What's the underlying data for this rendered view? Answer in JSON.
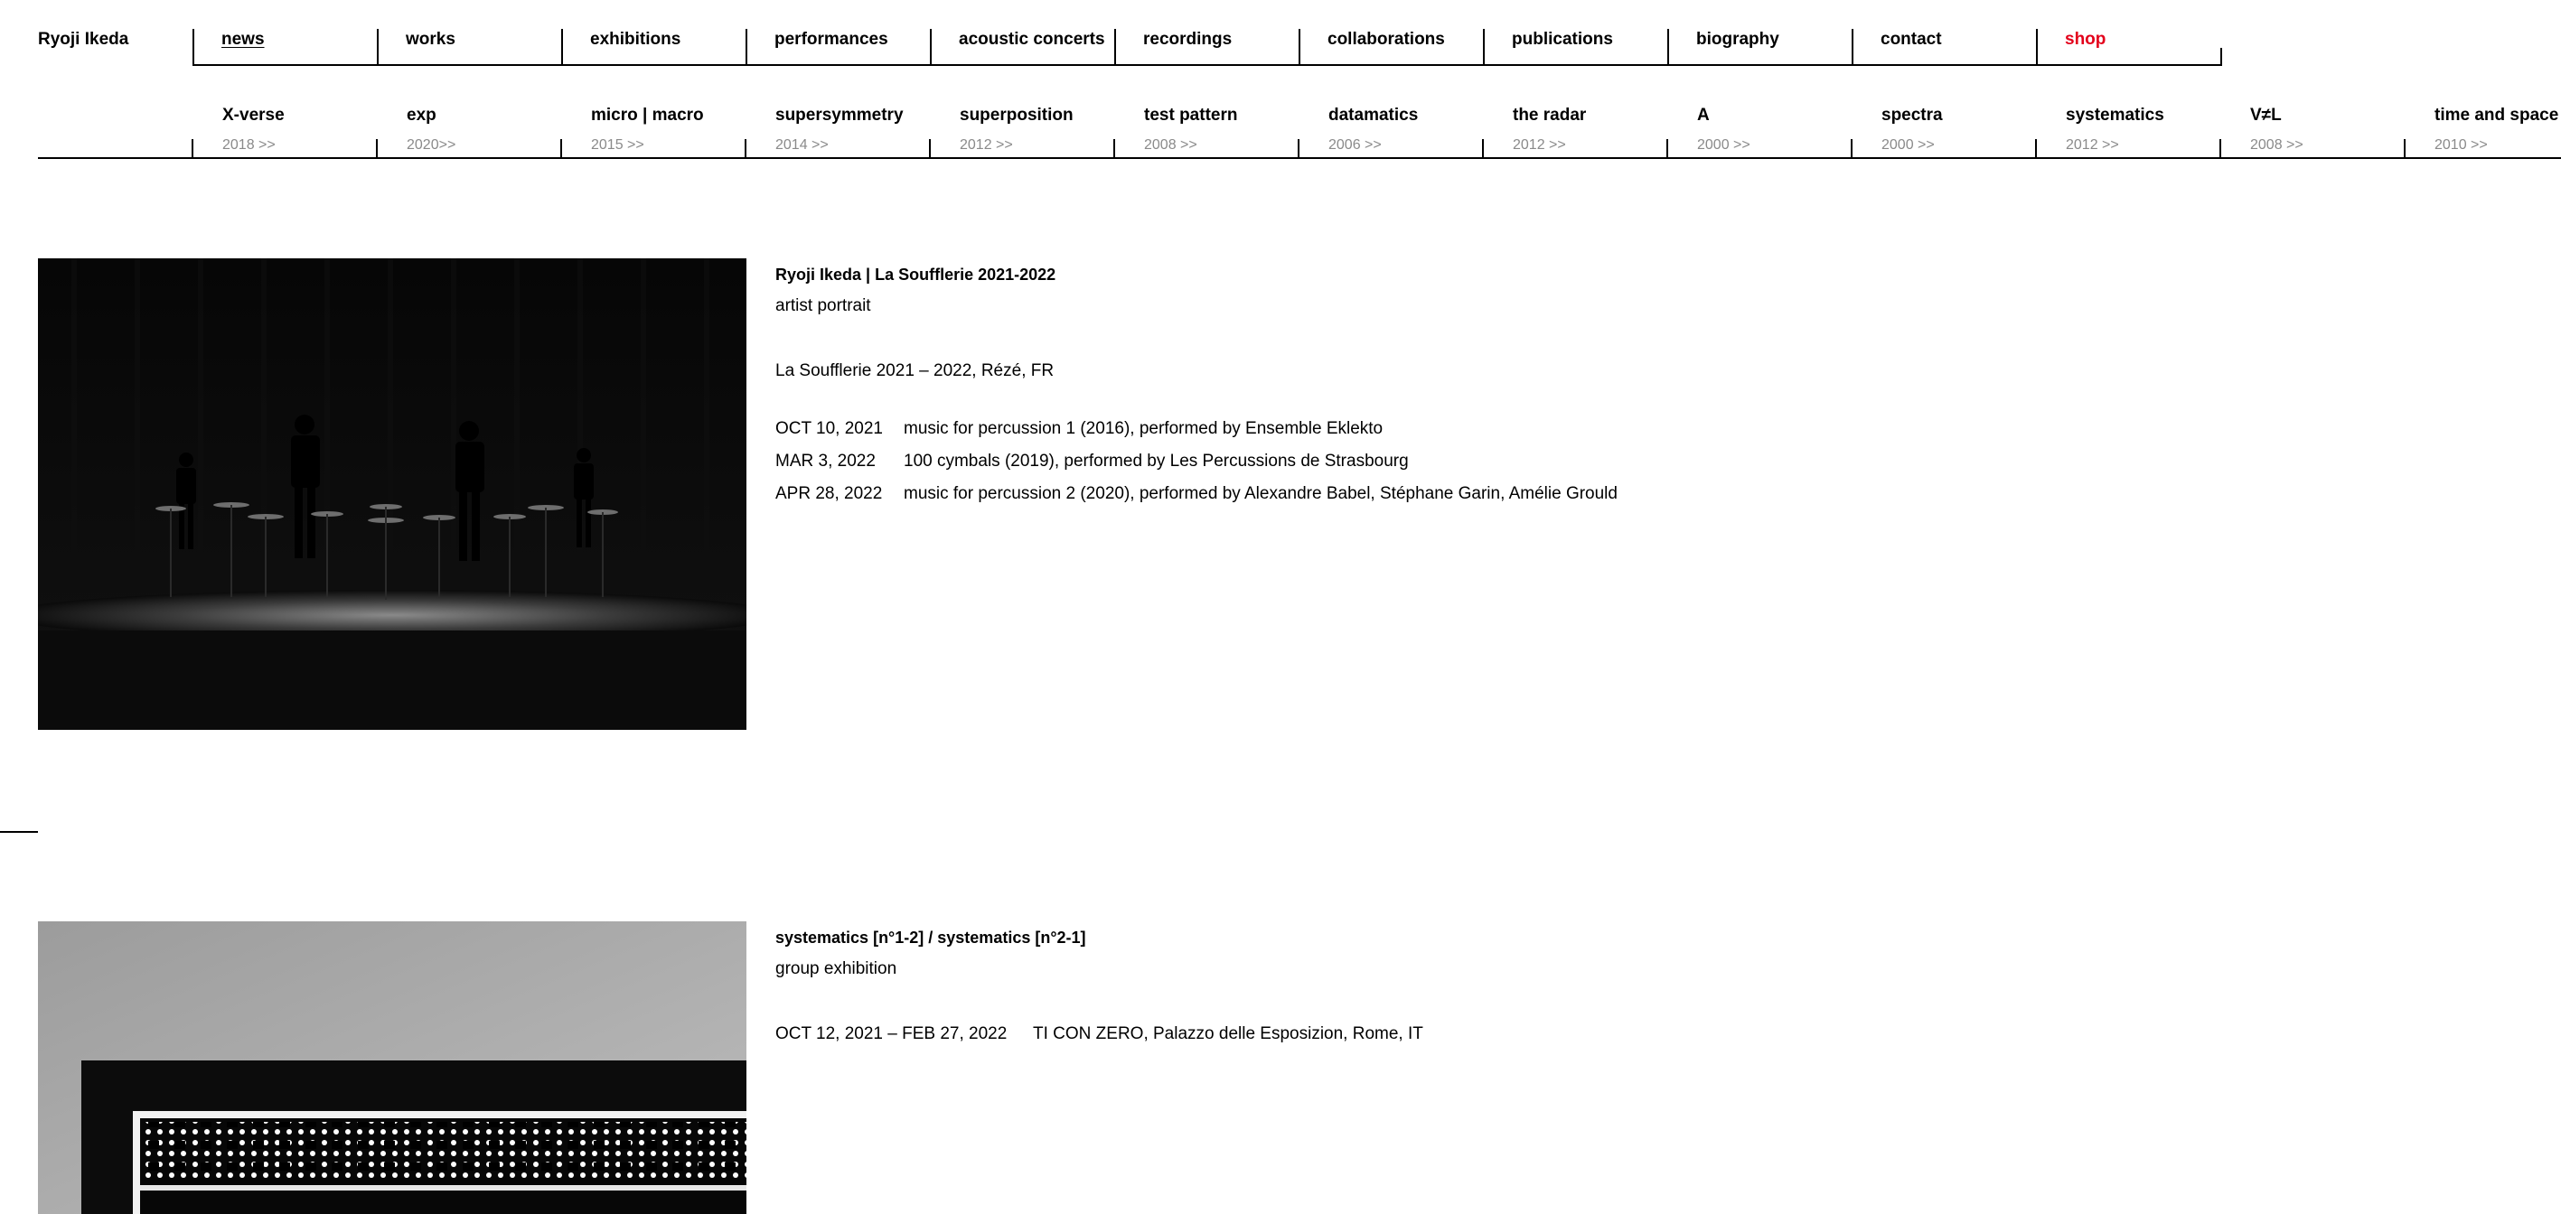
{
  "site": {
    "title": "Ryoji Ikeda"
  },
  "nav": {
    "items": [
      {
        "label": "news"
      },
      {
        "label": "works"
      },
      {
        "label": "exhibitions"
      },
      {
        "label": "performances"
      },
      {
        "label": "acoustic concerts"
      },
      {
        "label": "recordings"
      },
      {
        "label": "collaborations"
      },
      {
        "label": "publications"
      },
      {
        "label": "biography"
      },
      {
        "label": "contact"
      },
      {
        "label": "shop"
      }
    ],
    "active": "news",
    "shop_color": "#e3001b"
  },
  "works": {
    "items": [
      {
        "title": "X-verse",
        "year": "2018 >>"
      },
      {
        "title": "exp",
        "year": "2020>>"
      },
      {
        "title": "micro | macro",
        "year": "2015 >>"
      },
      {
        "title": "supersymmetry",
        "year": "2014 >>"
      },
      {
        "title": "superposition",
        "year": "2012 >>"
      },
      {
        "title": "test pattern",
        "year": "2008 >>"
      },
      {
        "title": "datamatics",
        "year": "2006 >>"
      },
      {
        "title": "the radar",
        "year": "2012 >>"
      },
      {
        "title": "A",
        "year": "2000 >>"
      },
      {
        "title": "spectra",
        "year": "2000 >>"
      },
      {
        "title": "systematics",
        "year": "2012 >>"
      },
      {
        "title": "V≠L",
        "year": "2008 >>"
      },
      {
        "title": "time and space",
        "year": "2010 >>"
      }
    ],
    "year_color": "#8a8a8a"
  },
  "entries": [
    {
      "title": "Ryoji Ikeda | La Soufflerie 2021-2022",
      "subtitle": "artist portrait",
      "venue": "La Soufflerie 2021 – 2022, Rézé, FR",
      "events": [
        {
          "date": "OCT 10, 2021",
          "text": "music for percussion 1 (2016), performed by Ensemble Eklekto"
        },
        {
          "date": "MAR 3, 2022",
          "text": "100 cymbals (2019), performed by Les Percussions de Strasbourg"
        },
        {
          "date": "APR 28, 2022",
          "text": "music for percussion 2 (2020), performed by Alexandre Babel, Stéphane Garin, Amélie Grould"
        }
      ]
    },
    {
      "title": "systematics [n°1-2] / systematics [n°2-1]",
      "subtitle": "group exhibition",
      "events": [
        {
          "date": "OCT 12, 2021 – FEB 27, 2022",
          "text": "TI CON ZERO, Palazzo delle Esposizion, Rome, IT"
        }
      ]
    }
  ]
}
